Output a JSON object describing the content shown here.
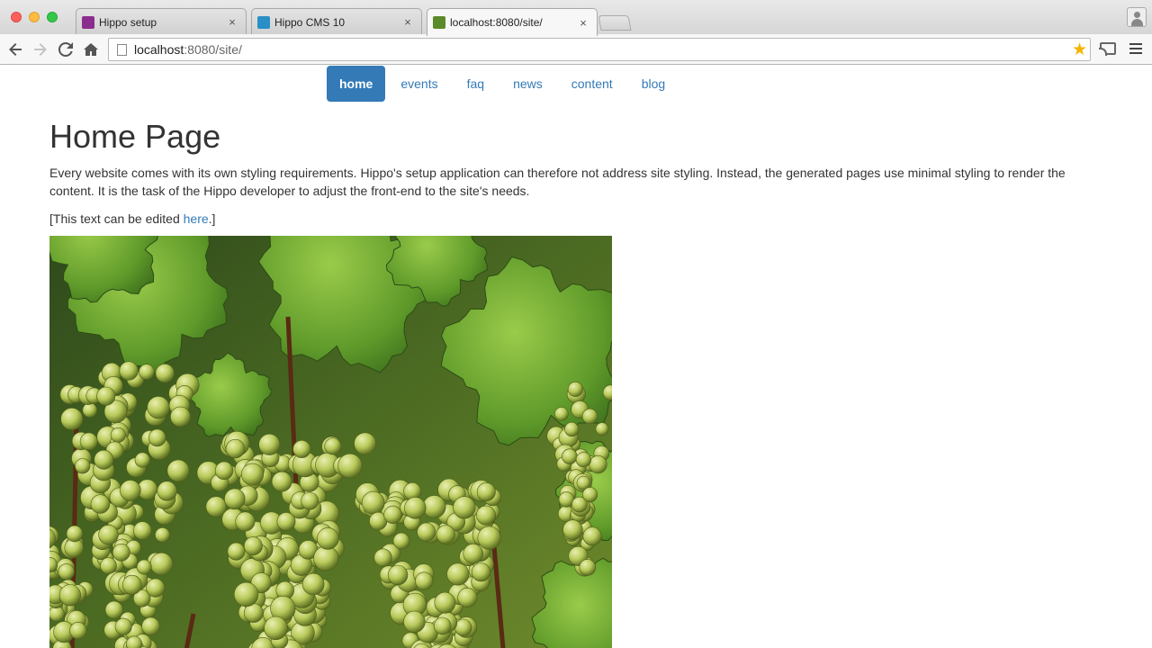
{
  "browser": {
    "tabs": [
      {
        "title": "Hippo setup",
        "favicon_color": "#8b2d8f",
        "active": false
      },
      {
        "title": "Hippo CMS 10",
        "favicon_color": "#2a8fc6",
        "active": false
      },
      {
        "title": "localhost:8080/site/",
        "favicon_color": "#5a8a2a",
        "active": true
      }
    ],
    "close_glyph": "×",
    "address": {
      "host": "localhost",
      "rest": ":8080/site/"
    },
    "icons": {
      "back": "back-arrow-icon",
      "forward": "forward-arrow-icon",
      "reload": "reload-icon",
      "home": "home-icon",
      "bookmark": "star-icon",
      "cast": "cast-icon",
      "menu": "hamburger-menu-icon",
      "profile": "profile-icon"
    }
  },
  "site": {
    "nav": [
      "home",
      "events",
      "faq",
      "news",
      "content",
      "blog"
    ],
    "active_nav": "home",
    "title": "Home Page",
    "intro": "Every website comes with its own styling requirements. Hippo's setup application can therefore not address site styling. Instead, the generated pages use minimal styling to render the content. It is the task of the Hippo developer to adjust the front-end to the site's needs.",
    "edit_note_prefix": "[This text can be edited ",
    "edit_note_link": "here",
    "edit_note_suffix": ".]",
    "accent_color": "#337ab7"
  }
}
